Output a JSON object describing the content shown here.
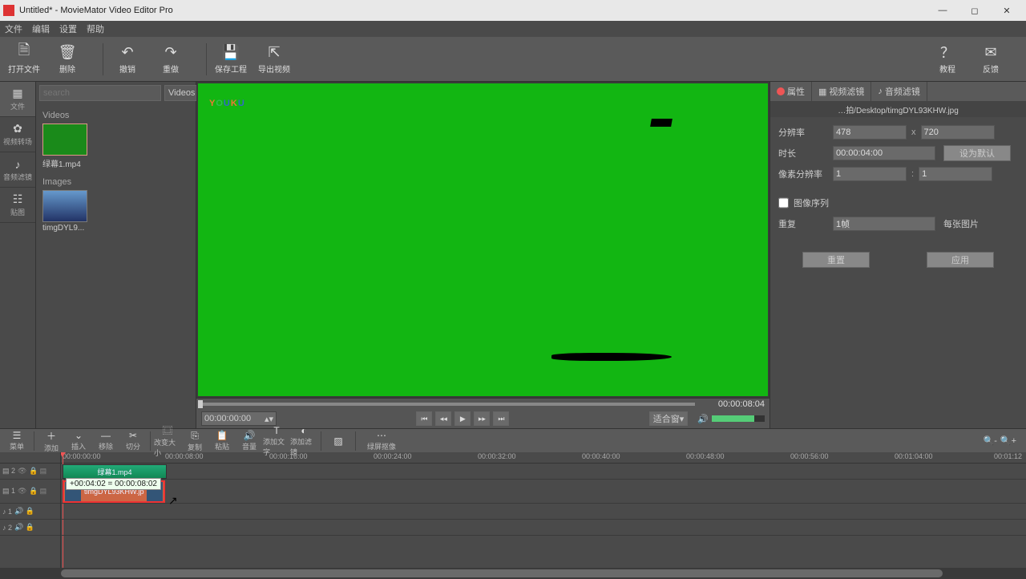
{
  "window": {
    "title": "Untitled* - MovieMator Video Editor Pro"
  },
  "menu": [
    "文件",
    "编辑",
    "设置",
    "帮助"
  ],
  "toolbar": {
    "open": "打开文件",
    "delete": "删除",
    "undo": "撤销",
    "redo": "重做",
    "save": "保存工程",
    "export": "导出视频",
    "tutorial": "教程",
    "feedback": "反馈"
  },
  "lefttabs": [
    {
      "icon": "▦",
      "label": "文件"
    },
    {
      "icon": "✿",
      "label": "视频转场"
    },
    {
      "icon": "♪",
      "label": "音频滤镜"
    },
    {
      "icon": "☷",
      "label": "贴图"
    }
  ],
  "media": {
    "search_placeholder": "search",
    "type": "Videos",
    "sec_videos": "Videos",
    "sec_images": "Images",
    "clip_video": "绿幕1.mp4",
    "clip_image": "timgDYL9..."
  },
  "preview": {
    "watermark": "YOUKU",
    "total_time": "00:00:08:04",
    "current_time": "00:00:00:00",
    "fit": "适合窗▾"
  },
  "prop": {
    "tab1": "属性",
    "tab2": "视频滤镜",
    "tab3": "音频滤镜",
    "path": "…拍/Desktop/timgDYL93KHW.jpg",
    "res_lbl": "分辨率",
    "res_w": "478",
    "res_h": "720",
    "dur_lbl": "时长",
    "dur": "00:00:04:00",
    "dur_btn": "设为默认",
    "par_lbl": "像素分辨率",
    "par_a": "1",
    "par_b": "1",
    "seq_lbl": "图像序列",
    "rep_lbl": "重复",
    "rep_val": "1帧",
    "rep_unit": "每张图片",
    "reset": "重置",
    "apply": "应用"
  },
  "tltool": {
    "menu": "菜单",
    "add": "添加",
    "ins": "插入",
    "del": "移除",
    "cut": "切分",
    "resize": "改变大小",
    "copy": "复制",
    "paste": "粘贴",
    "vol": "音量",
    "text": "添加文字",
    "filter": "添加滤镜",
    "cover": "",
    "split": "绿屏抠像"
  },
  "ruler": [
    "00:00:00:00",
    "00:00:08:00",
    "00:00:16:00",
    "00:00:24:00",
    "00:00:32:00",
    "00:00:40:00",
    "00:00:48:00",
    "00:00:56:00",
    "00:01:04:00",
    "00:01:12"
  ],
  "tracks": {
    "v2": "▤ 2",
    "v1": "▤ 1",
    "a1": "♪ 1",
    "a2": "♪ 2",
    "clip1": "绿幕1.mp4",
    "clip2": "timgDYL93KHW.jp",
    "tooltip": "+00:04:02 = 00:00:08:02"
  }
}
